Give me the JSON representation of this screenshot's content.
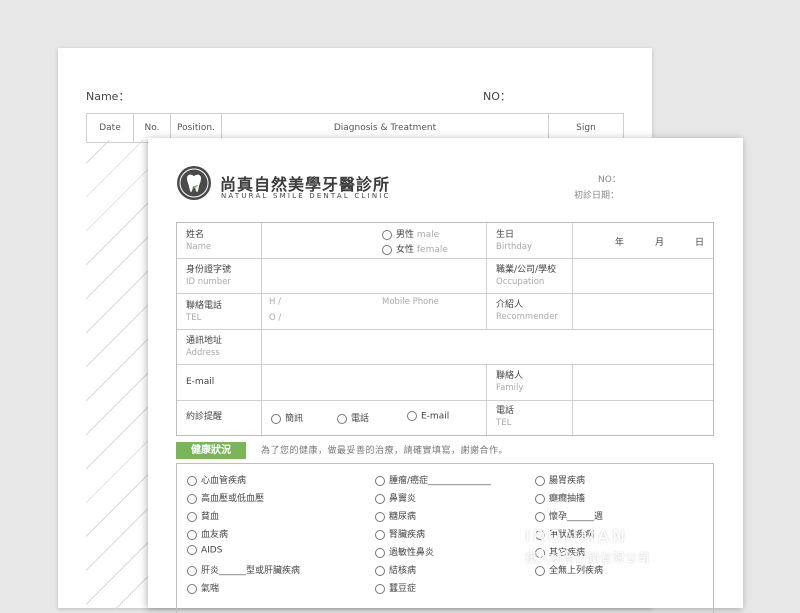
{
  "back_form": {
    "name_label": "Name：",
    "no_label": "NO：",
    "columns": [
      "Date",
      "No.",
      "Position.",
      "Diagnosis & Treatment",
      "Sign"
    ]
  },
  "front_form": {
    "clinic_name_zh": "尚真自然美學牙醫診所",
    "clinic_name_en": "NATURAL SMILE DENTAL CLINIC",
    "no_label": "NO：",
    "first_visit_label": "初診日期：",
    "fields": {
      "name_zh": "姓名",
      "name_en": "Name",
      "male_zh": "男性",
      "male_en": "male",
      "female_zh": "女性",
      "female_en": "female",
      "birthday_zh": "生日",
      "birthday_en": "Birthday",
      "year": "年",
      "month": "月",
      "day": "日",
      "id_zh": "身份證字號",
      "id_en": "ID number",
      "occupation_zh": "職業/公司/學校",
      "occupation_en": "Occupation",
      "tel_zh": "聯絡電話",
      "tel_en": "TEL",
      "tel_home": "H /",
      "tel_office": "O /",
      "mobile": "Mobile Phone",
      "referrer_zh": "介紹人",
      "referrer_en": "Recommender",
      "address_zh": "通訊地址",
      "address_en": "Address",
      "email": "E-mail",
      "contact_zh": "聯絡人",
      "contact_en": "Family",
      "reminder_zh": "約診提醒",
      "reminder_opts": [
        "簡訊",
        "電話",
        "E-mail"
      ],
      "contact_tel_zh": "電話",
      "contact_tel_en": "TEL"
    },
    "health": {
      "title": "健康狀況",
      "note": "為了您的健康，做最妥善的治療，請確實填寫，謝謝合作。",
      "col1": [
        "心血管疾病",
        "高血壓或低血壓",
        "貧血",
        "血友病",
        "AIDS",
        "肝炎______型或肝臟疾病",
        "氣喘"
      ],
      "col2": [
        "腫瘤/癌症______________",
        "鼻竇炎",
        "糖尿病",
        "腎臟疾病",
        "過敏性鼻炎",
        "結核病",
        "蠶豆症"
      ],
      "col3": [
        "腸胃疾病",
        "癲癇抽搐",
        "懷孕______週",
        "甲狀腺疾病",
        "其它疾病",
        "全無上列疾病"
      ]
    }
  },
  "watermark": {
    "brand": "IRONMAN",
    "company": "鐵人創意行銷有限公司"
  },
  "colors": {
    "accent_green": "#7ab55c",
    "line_gray": "#cfcfcf"
  }
}
